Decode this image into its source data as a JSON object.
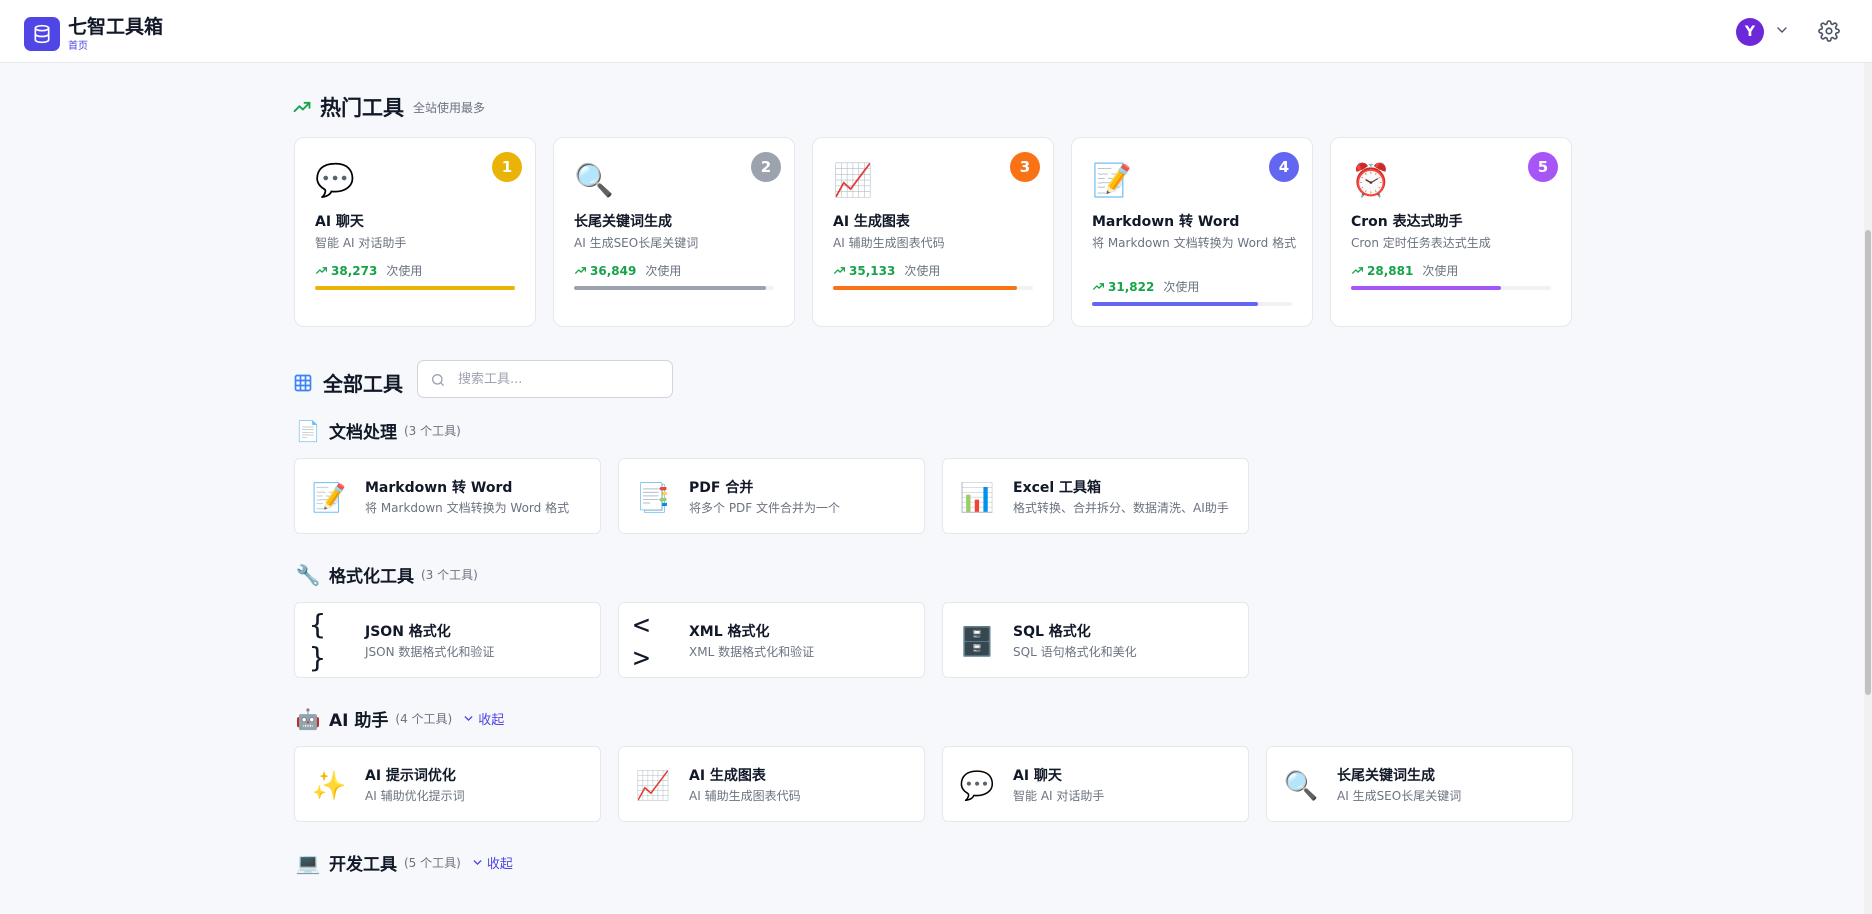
{
  "header": {
    "app_title": "七智工具箱",
    "breadcrumb": "首页",
    "avatar_letter": "Y",
    "brand_color": "#4f46e5",
    "icons": [
      "database-icon",
      "chevron-down-icon",
      "gear-icon"
    ]
  },
  "hot_section": {
    "title": "热门工具",
    "subtitle": "全站使用最多",
    "icon": "trending-up-icon",
    "usage_unit": "次使用",
    "cards": [
      {
        "rank": "1",
        "emoji": "💬",
        "name": "AI 聊天",
        "desc": "智能 AI 对话助手",
        "count": "38,273",
        "fill_fraction": 1.0,
        "badge_color": "#eab308",
        "bar_color": "#eab308"
      },
      {
        "rank": "2",
        "emoji": "🔍",
        "name": "长尾关键词生成",
        "desc": "AI 生成SEO长尾关键词",
        "count": "36,849",
        "fill_fraction": 0.96,
        "badge_color": "#9ca3af",
        "bar_color": "#9ca3af"
      },
      {
        "rank": "3",
        "emoji": "📈",
        "name": "AI 生成图表",
        "desc": "AI 辅助生成图表代码",
        "count": "35,133",
        "fill_fraction": 0.92,
        "badge_color": "#f97316",
        "bar_color": "#f97316"
      },
      {
        "rank": "4",
        "emoji": "📝",
        "name": "Markdown 转 Word",
        "desc": "将 Markdown 文档转换为 Word 格式",
        "count": "31,822",
        "fill_fraction": 0.83,
        "badge_color": "#6366f1",
        "bar_color": "#6366f1"
      },
      {
        "rank": "5",
        "emoji": "⏰",
        "name": "Cron 表达式助手",
        "desc": "Cron 定时任务表达式生成",
        "count": "28,881",
        "fill_fraction": 0.75,
        "badge_color": "#a855f7",
        "bar_color": "#a855f7"
      }
    ]
  },
  "all_tools": {
    "title": "全部工具",
    "icon": "grid-icon",
    "search_placeholder": "搜索工具...",
    "collapse_label": "收起",
    "categories": [
      {
        "title": "文档处理",
        "count": "(3 个工具)",
        "emoji": "📄",
        "collapsible": false,
        "tools": [
          {
            "emoji": "📝",
            "name": "Markdown 转 Word",
            "desc": "将 Markdown 文档转换为 Word 格式"
          },
          {
            "emoji": "📑",
            "name": "PDF 合并",
            "desc": "将多个 PDF 文件合并为一个"
          },
          {
            "emoji": "📊",
            "name": "Excel 工具箱",
            "desc": "格式转换、合并拆分、数据清洗、AI助手"
          }
        ]
      },
      {
        "title": "格式化工具",
        "count": "(3 个工具)",
        "emoji": "🔧",
        "collapsible": false,
        "tools": [
          {
            "emoji": "{ }",
            "name": "JSON 格式化",
            "desc": "JSON 数据格式化和验证"
          },
          {
            "emoji": "< >",
            "name": "XML 格式化",
            "desc": "XML 数据格式化和验证"
          },
          {
            "emoji": "🗄️",
            "name": "SQL 格式化",
            "desc": "SQL 语句格式化和美化"
          }
        ]
      },
      {
        "title": "AI 助手",
        "count": "(4 个工具)",
        "emoji": "🤖",
        "collapsible": true,
        "tools": [
          {
            "emoji": "✨",
            "name": "AI 提示词优化",
            "desc": "AI 辅助优化提示词"
          },
          {
            "emoji": "📈",
            "name": "AI 生成图表",
            "desc": "AI 辅助生成图表代码"
          },
          {
            "emoji": "💬",
            "name": "AI 聊天",
            "desc": "智能 AI 对话助手"
          },
          {
            "emoji": "🔍",
            "name": "长尾关键词生成",
            "desc": "AI 生成SEO长尾关键词"
          }
        ]
      },
      {
        "title": "开发工具",
        "count": "(5 个工具)",
        "emoji": "💻",
        "collapsible": true,
        "tools": []
      }
    ]
  }
}
